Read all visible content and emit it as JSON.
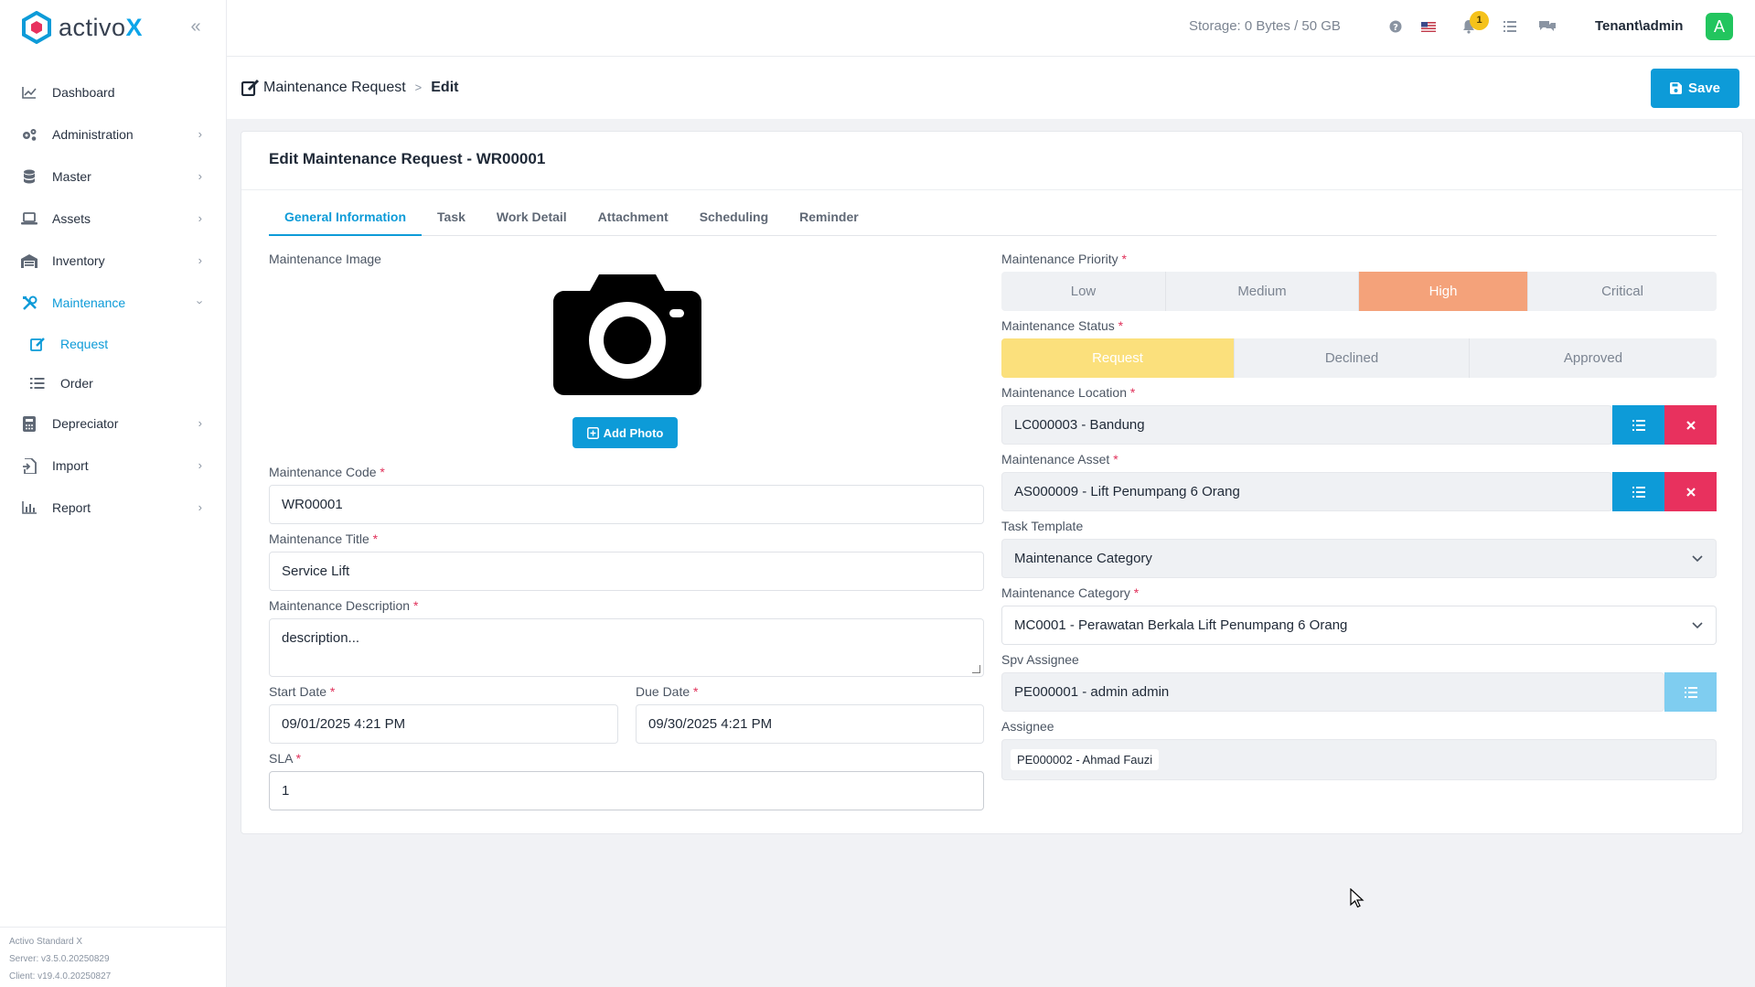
{
  "brand": {
    "name": "activo",
    "suffix": "X"
  },
  "sidebar": {
    "items": [
      {
        "label": "Dashboard",
        "icon": "chart-line-icon",
        "chevron": false
      },
      {
        "label": "Administration",
        "icon": "gears-icon",
        "chevron": true
      },
      {
        "label": "Master",
        "icon": "database-icon",
        "chevron": true
      },
      {
        "label": "Assets",
        "icon": "laptop-icon",
        "chevron": true
      },
      {
        "label": "Inventory",
        "icon": "warehouse-icon",
        "chevron": true
      },
      {
        "label": "Maintenance",
        "icon": "tools-icon",
        "chevron": true,
        "active": true
      },
      {
        "label": "Request",
        "icon": "edit-icon",
        "sub": true,
        "active": true
      },
      {
        "label": "Order",
        "icon": "list-icon",
        "sub": true
      },
      {
        "label": "Depreciator",
        "icon": "calculator-icon",
        "chevron": true
      },
      {
        "label": "Import",
        "icon": "import-icon",
        "chevron": true
      },
      {
        "label": "Report",
        "icon": "chart-bar-icon",
        "chevron": true
      }
    ],
    "footer": {
      "product": "Activo Standard X",
      "server": "Server: v3.5.0.20250829",
      "client": "Client: v19.4.0.20250827"
    }
  },
  "topbar": {
    "storage": "Storage: 0 Bytes / 50 GB",
    "notification_count": "1",
    "tenant": "Tenant\\admin",
    "avatar_letter": "A"
  },
  "breadcrumb": {
    "parent": "Maintenance Request",
    "current": "Edit"
  },
  "toolbar": {
    "save_label": "Save"
  },
  "card": {
    "title": "Edit Maintenance Request - WR00001",
    "tabs": [
      "General Information",
      "Task",
      "Work Detail",
      "Attachment",
      "Scheduling",
      "Reminder"
    ]
  },
  "form": {
    "image_label": "Maintenance Image",
    "add_photo": "Add Photo",
    "code_label": "Maintenance Code",
    "code_value": "WR00001",
    "title_label": "Maintenance Title",
    "title_value": "Service Lift",
    "desc_label": "Maintenance Description",
    "desc_value": "description...",
    "start_label": "Start Date",
    "start_value": "09/01/2025 4:21 PM",
    "due_label": "Due Date",
    "due_value": "09/30/2025 4:21 PM",
    "sla_label": "SLA",
    "sla_value": "1",
    "priority_label": "Maintenance Priority",
    "priority_options": [
      "Low",
      "Medium",
      "High",
      "Critical"
    ],
    "priority_selected": "High",
    "status_label": "Maintenance Status",
    "status_options": [
      "Request",
      "Declined",
      "Approved"
    ],
    "status_selected": "Request",
    "location_label": "Maintenance Location",
    "location_value": "LC000003 - Bandung",
    "asset_label": "Maintenance Asset",
    "asset_value": "AS000009 - Lift Penumpang 6 Orang",
    "template_label": "Task Template",
    "template_value": "Maintenance Category",
    "category_label": "Maintenance Category",
    "category_value": "MC0001 - Perawatan Berkala Lift Penumpang 6 Orang",
    "spv_label": "Spv Assignee",
    "spv_value": "PE000001 - admin admin",
    "assignee_label": "Assignee",
    "assignee_tag": "PE000002 - Ahmad Fauzi",
    "required_mark": "*"
  },
  "colors": {
    "accent": "#0d9bd8",
    "danger": "#e8315e",
    "priority_high": "#f4a27a",
    "status_request": "#fbe07c",
    "badge": "#f5c21b",
    "avatar": "#22c55e"
  }
}
